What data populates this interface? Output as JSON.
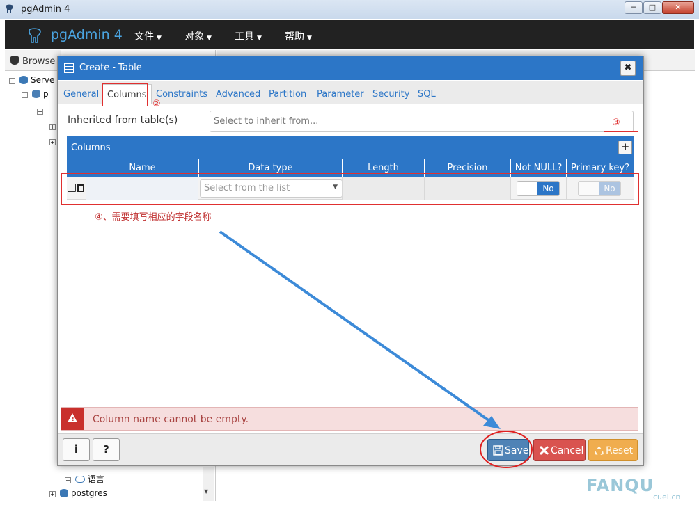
{
  "window": {
    "title": "pgAdmin 4",
    "min": "─",
    "max": "□",
    "close": "✕"
  },
  "navbar": {
    "brand": "pgAdmin 4",
    "menus": [
      {
        "label": "文件"
      },
      {
        "label": "对象"
      },
      {
        "label": "工具"
      },
      {
        "label": "帮助"
      }
    ]
  },
  "browser": {
    "tab": "Browse",
    "tree": [
      {
        "label": "Serve"
      },
      {
        "label": "p"
      },
      {
        "label": "语言"
      },
      {
        "label": "postgres"
      }
    ]
  },
  "dialog": {
    "title": "Create - Table",
    "close": "✖",
    "tabs": [
      "General",
      "Columns",
      "Constraints",
      "Advanced",
      "Partition",
      "Parameter",
      "Security",
      "SQL"
    ],
    "active_tab": "Columns",
    "inherit": {
      "label": "Inherited from table(s)",
      "placeholder": "Select to inherit from..."
    },
    "columns_panel": {
      "title": "Columns",
      "add": "+",
      "headers": [
        "Name",
        "Data type",
        "Length",
        "Precision",
        "Not NULL?",
        "Primary key?"
      ],
      "row": {
        "datatype_placeholder": "Select from the list",
        "not_null": "No",
        "primary_key": "No"
      }
    },
    "error": "Column name cannot be empty.",
    "footer": {
      "info": "i",
      "help": "?",
      "save": "Save",
      "cancel": "Cancel",
      "reset": "Reset"
    }
  },
  "annotations": {
    "step2": "②",
    "step3": "③",
    "step4": "④、需要填写相应的字段名称"
  },
  "colors": {
    "primary": "#2c76c7",
    "navbar": "#222222",
    "error_bg": "#f6dede",
    "annotation": "#e03030",
    "arrow": "#3c8ad8"
  }
}
